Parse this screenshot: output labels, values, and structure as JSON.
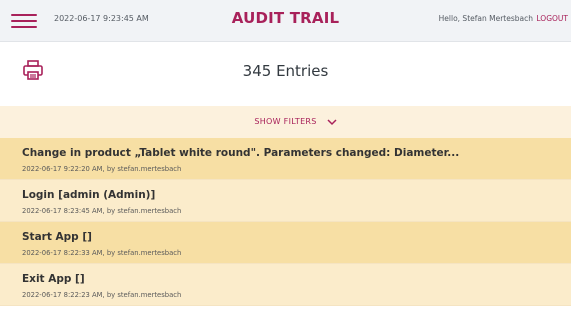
{
  "header": {
    "menu_icon": "hamburger-menu-icon",
    "datetime": "2022-06-17 9:23:45 AM",
    "title": "AUDIT TRAIL",
    "greeting": "Hello, Stefan Mertesbach",
    "logout_label": "LOGOUT"
  },
  "toolbar": {
    "print_icon": "printer-icon",
    "entries_count": "345 Entries"
  },
  "filters": {
    "label": "SHOW FILTERS",
    "chevron_icon": "chevron-down-icon"
  },
  "entries": [
    {
      "title": "Change in product „Tablet white round\". Parameters changed: Diameter...",
      "meta": "2022-06-17 9:22:20 AM, by stefan.mertesbach"
    },
    {
      "title": "Login [admin (Admin)]",
      "meta": "2022-06-17 8:23:45 AM, by stefan.mertesbach"
    },
    {
      "title": "Start App []",
      "meta": "2022-06-17 8:22:33 AM, by stefan.mertesbach"
    },
    {
      "title": "Exit App []",
      "meta": "2022-06-17 8:22:23 AM, by stefan.mertesbach"
    }
  ],
  "colors": {
    "accent": "#a8215a",
    "header_bg": "#f1f3f6",
    "filter_bg": "#fcf1dd",
    "row_dark": "#f7dfa4",
    "row_light": "#fbeccb"
  }
}
